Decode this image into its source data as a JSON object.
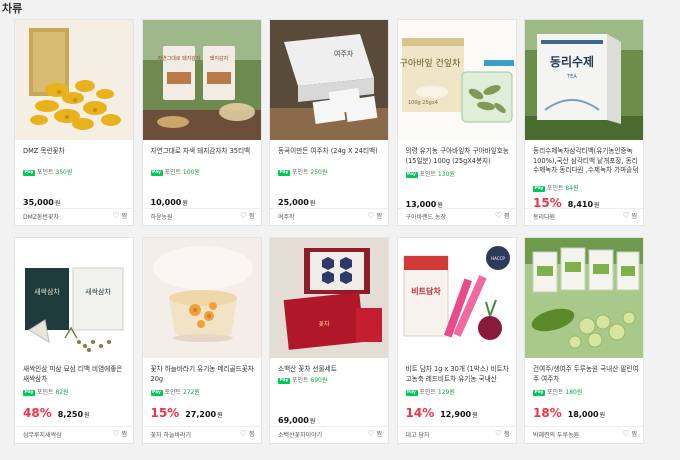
{
  "section": {
    "title": "차류"
  },
  "labels": {
    "points_prefix": "포인트",
    "pay_badge": "Pay",
    "won": "원",
    "wish": "찜",
    "heart": "♡"
  },
  "products": [
    {
      "title": "DMZ 목련꽃차",
      "points": "350원",
      "discount": "",
      "price": "35,000",
      "seller": "DMZ동번꽃차"
    },
    {
      "title": "자연그대로 자색 돼지감자차 35티백",
      "points": "100원",
      "discount": "",
      "price": "10,000",
      "seller": "하윤농원"
    },
    {
      "title": "동곡이만든 여주차 (24g X 24티백)",
      "points": "250원",
      "discount": "",
      "price": "25,000",
      "seller": "여주작"
    },
    {
      "title": "의령 유기농 구아바잎차 구아바잎호능 (15일분) 100g (25gX4봉지)",
      "points": "130원",
      "discount": "",
      "price": "13,000",
      "seller": "구아바랜드 농장"
    },
    {
      "title": "동리수제녹차삼각티백(유기농인증녹100%),국산 삼각티백 낱개포장, 동리수제녹차 동리다원 ,수제녹차 가마솥덖",
      "points": "84원",
      "discount": "15%",
      "price": "8,410",
      "seller": "동리다원"
    },
    {
      "title": "새싹인삼 미삼 묘삼 티백 비염에좋은 새싹삼차",
      "points": "82원",
      "discount": "48%",
      "price": "8,250",
      "seller": "삼무루지새싹삼"
    },
    {
      "title": "꽃차 하늘바라기 유기농 메리골드꽃차 20g",
      "points": "272원",
      "discount": "15%",
      "price": "27,200",
      "seller": "꽃차 하늘바라기"
    },
    {
      "title": "소백산 꽃차 선물세트",
      "points": "690원",
      "discount": "",
      "price": "69,000",
      "seller": "소백산꽃차이야기"
    },
    {
      "title": "비트 담차 1g x 30개 (1박스) 비트차 고농축 레드비트차 유기농 국내산",
      "points": "129원",
      "discount": "14%",
      "price": "12,900",
      "seller": "대고 담차"
    },
    {
      "title": "건여주/생여주 두루농원 국내산 말린여주 여주차",
      "points": "180원",
      "discount": "18%",
      "price": "18,000",
      "seller": "박혜련의 두루농원"
    }
  ],
  "image_text": {
    "p2_left": "자연그대로 돼지감자",
    "p2_right": "돼지감자",
    "p3_box": "여주차",
    "p4_box": "구아바잎 건잎차",
    "p4_weight": "100g 25gx4",
    "p5_box": "동리수제",
    "p5_tea": "TEA",
    "p6_box": "새싹삼차",
    "p8_label": "꽃차",
    "p9_box": "비트담차",
    "p9_mark": "HACCP"
  },
  "colors": {
    "accent_red": "#f0334c",
    "npay_green": "#03c75a"
  }
}
